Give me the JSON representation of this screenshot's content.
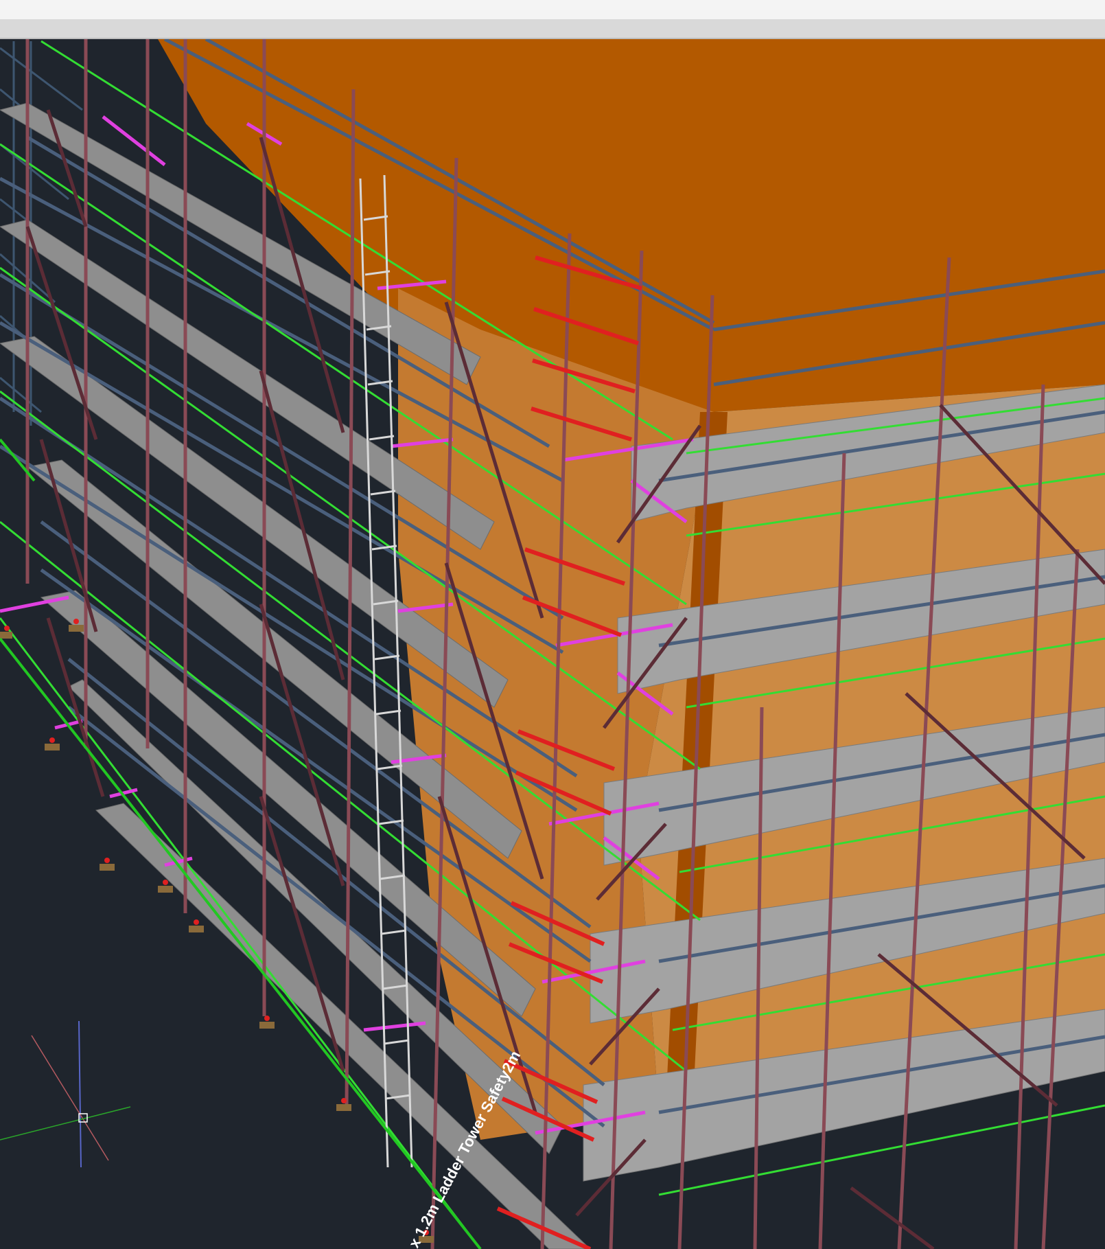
{
  "window": {
    "title": ""
  },
  "viewport": {
    "view_type": "3D model view",
    "background_color": "#1f252d",
    "annotation_text": "x 1.2m Ladder Tower Safety2m",
    "colors": {
      "building_wall": "#b35900",
      "building_wall_light": "#cc8a44",
      "deck": "#8e8e8e",
      "ledger": "#4a5f7c",
      "guardrail": "#33dd33",
      "standard": "#8a4a55",
      "brace": "#5c2c36",
      "transom": "#e040e0",
      "tie": "#e02020",
      "ladder": "#d8d8d8",
      "base_plate": "#8a6a3a"
    },
    "icons": [
      "ucs-crosshair-icon"
    ]
  }
}
